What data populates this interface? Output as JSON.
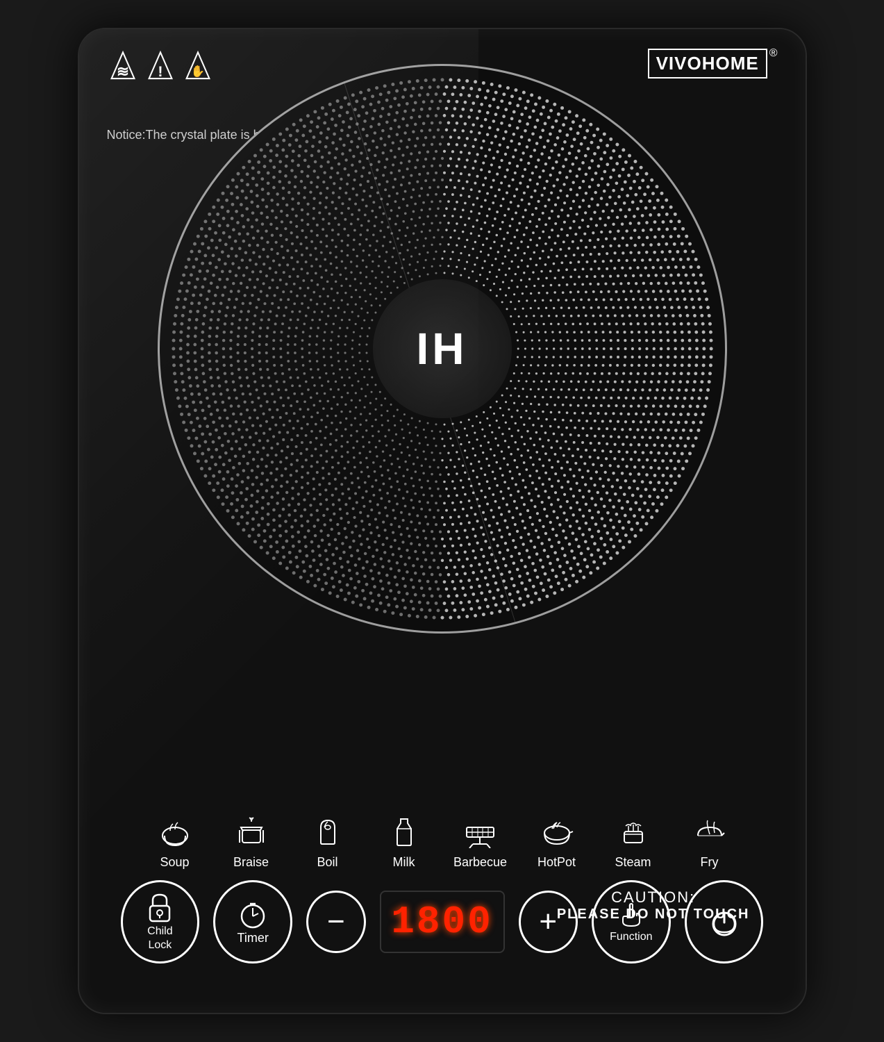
{
  "brand": {
    "name_vivo": "VIVO",
    "name_home": "HOME",
    "registered": "®"
  },
  "notice": {
    "text": "Notice:The crystal plate is hot after cooking,please do not touch with your hand"
  },
  "plate": {
    "center_text": "IH"
  },
  "caution": {
    "title": "CAUTION:",
    "subtitle": "PLEASE DO NOT TOUCH"
  },
  "modes": [
    {
      "id": "soup",
      "label": "Soup"
    },
    {
      "id": "braise",
      "label": "Braise"
    },
    {
      "id": "boil",
      "label": "Boil"
    },
    {
      "id": "milk",
      "label": "Milk"
    },
    {
      "id": "barbecue",
      "label": "Barbecue"
    },
    {
      "id": "hotpot",
      "label": "HotPot"
    },
    {
      "id": "steam",
      "label": "Steam"
    },
    {
      "id": "fry",
      "label": "Fry"
    }
  ],
  "controls": {
    "child_lock_label": "Child\nLock",
    "timer_label": "Timer",
    "minus_label": "−",
    "display_value": "1800",
    "plus_label": "+",
    "function_label": "Function",
    "power_label": ""
  }
}
